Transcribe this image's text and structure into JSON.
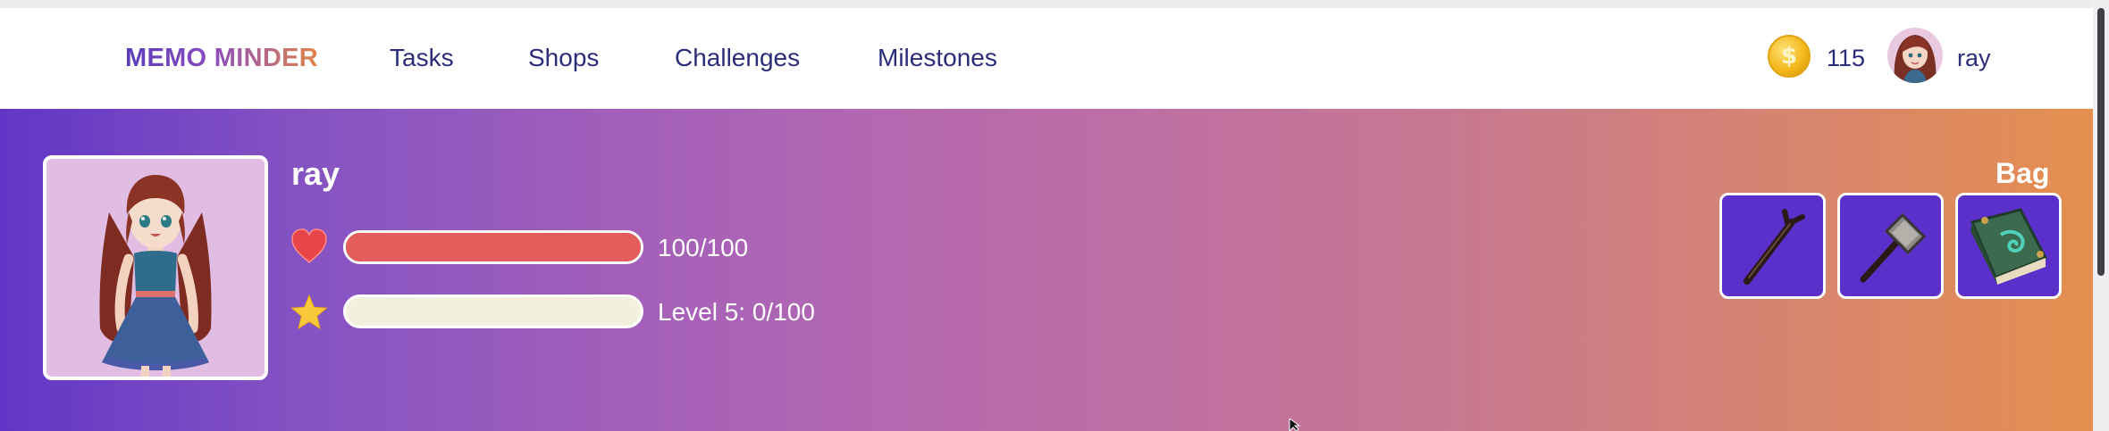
{
  "nav": {
    "brand": "MEMO MINDER",
    "links": [
      "Tasks",
      "Shops",
      "Challenges",
      "Milestones"
    ],
    "coin_glyph": "$",
    "coins": "115",
    "username": "ray"
  },
  "profile": {
    "name": "ray",
    "health": {
      "text": "100/100",
      "value": 100,
      "max": 100,
      "color": "#e35d5d"
    },
    "experience": {
      "text": "Level 5: 0/100",
      "value": 0,
      "max": 100,
      "color": "#f3f1de"
    }
  },
  "bag": {
    "title": "Bag",
    "items": [
      {
        "icon": "wooden-staff-icon"
      },
      {
        "icon": "hammer-icon"
      },
      {
        "icon": "spellbook-icon"
      }
    ]
  },
  "colors": {
    "nav_text": "#2b2d7a",
    "banner_start": "#6236c6",
    "banner_end": "#e58f4f",
    "slot_bg": "#5b2fca"
  }
}
